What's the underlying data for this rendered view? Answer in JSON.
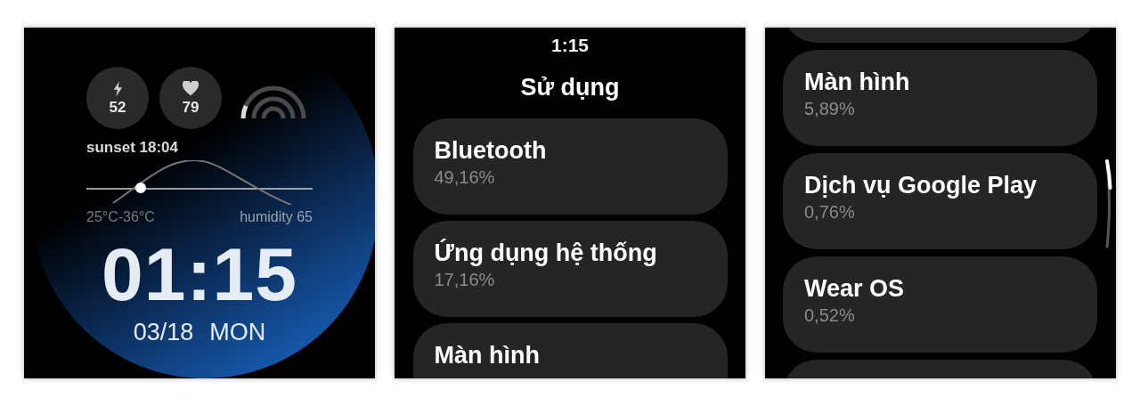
{
  "watch_face": {
    "complications": [
      {
        "kind": "energy",
        "value": "52"
      },
      {
        "kind": "heart",
        "value": "79"
      }
    ],
    "sunset": "sunset 18:04",
    "temperature": "25°C-36°C",
    "humidity": "humidity 65",
    "time": "01:15",
    "date": "03/18",
    "weekday": "MON"
  },
  "usage_screen": {
    "clock": "1:15",
    "title": "Sử dụng",
    "items": [
      {
        "name": "Bluetooth",
        "percent": "49,16%"
      },
      {
        "name": "Ứng dụng hệ thống",
        "percent": "17,16%"
      },
      {
        "name": "Màn hình"
      }
    ]
  },
  "usage_screen_scrolled": {
    "items": [
      {
        "kind": "cut_off"
      },
      {
        "kind": "entry",
        "name": "Màn hình",
        "percent": "5,89%"
      },
      {
        "kind": "entry",
        "name": "Dịch vụ Google Play",
        "percent": "0,76%"
      },
      {
        "kind": "entry",
        "name": "Wear OS",
        "percent": "0,52%"
      },
      {
        "kind": "cut_off"
      }
    ]
  }
}
